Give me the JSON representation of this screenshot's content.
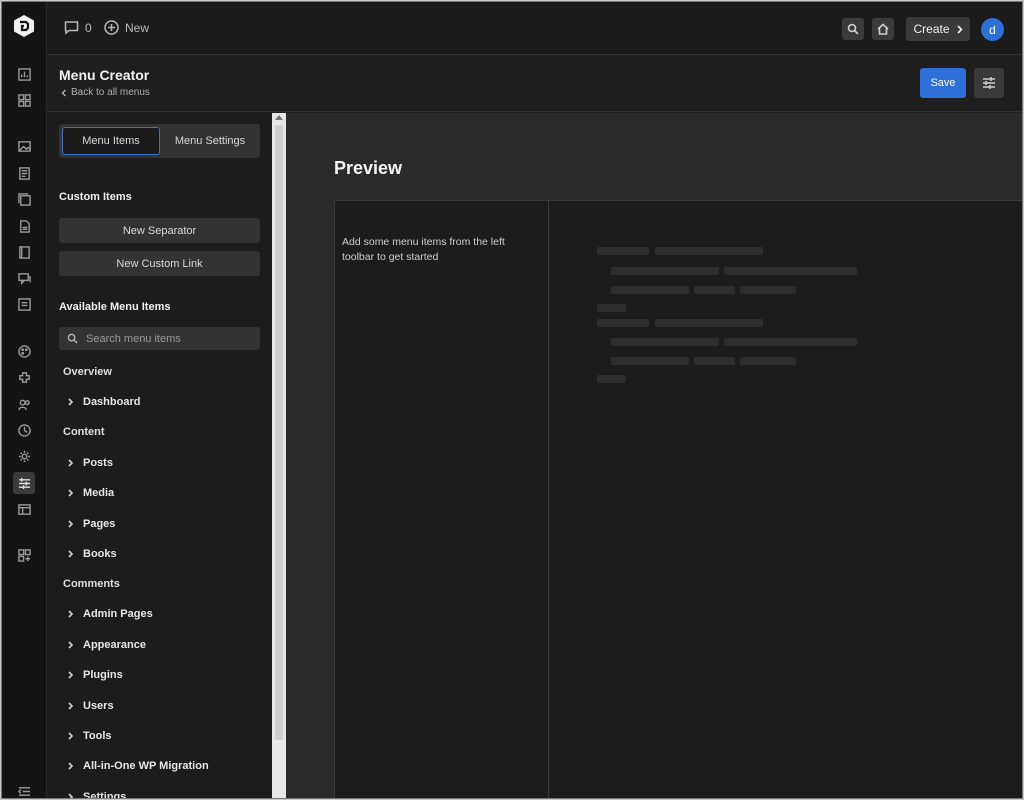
{
  "topbar": {
    "comments_count": "0",
    "new_label": "New",
    "create_label": "Create",
    "avatar_letter": "d"
  },
  "header": {
    "title": "Menu Creator",
    "back_label": "Back to all menus",
    "save_label": "Save"
  },
  "panel": {
    "tabs": [
      {
        "label": "Menu Items",
        "active": true
      },
      {
        "label": "Menu Settings",
        "active": false
      }
    ],
    "custom_title": "Custom Items",
    "new_separator": "New Separator",
    "new_custom_link": "New Custom Link",
    "available_title": "Available Menu Items",
    "search_placeholder": "Search menu items",
    "groups": {
      "overview": "Overview",
      "content": "Content",
      "comments": "Comments"
    },
    "items": {
      "dashboard": "Dashboard",
      "posts": "Posts",
      "media": "Media",
      "pages": "Pages",
      "books": "Books",
      "admin_pages": "Admin Pages",
      "appearance": "Appearance",
      "plugins": "Plugins",
      "users": "Users",
      "tools": "Tools",
      "migration": "All-in-One WP Migration",
      "settings": "Settings"
    }
  },
  "preview": {
    "title": "Preview",
    "empty_message": "Add some menu items from the left toolbar to get started"
  },
  "colors": {
    "accent": "#2f6fd9",
    "background": "#1f1f1f"
  }
}
